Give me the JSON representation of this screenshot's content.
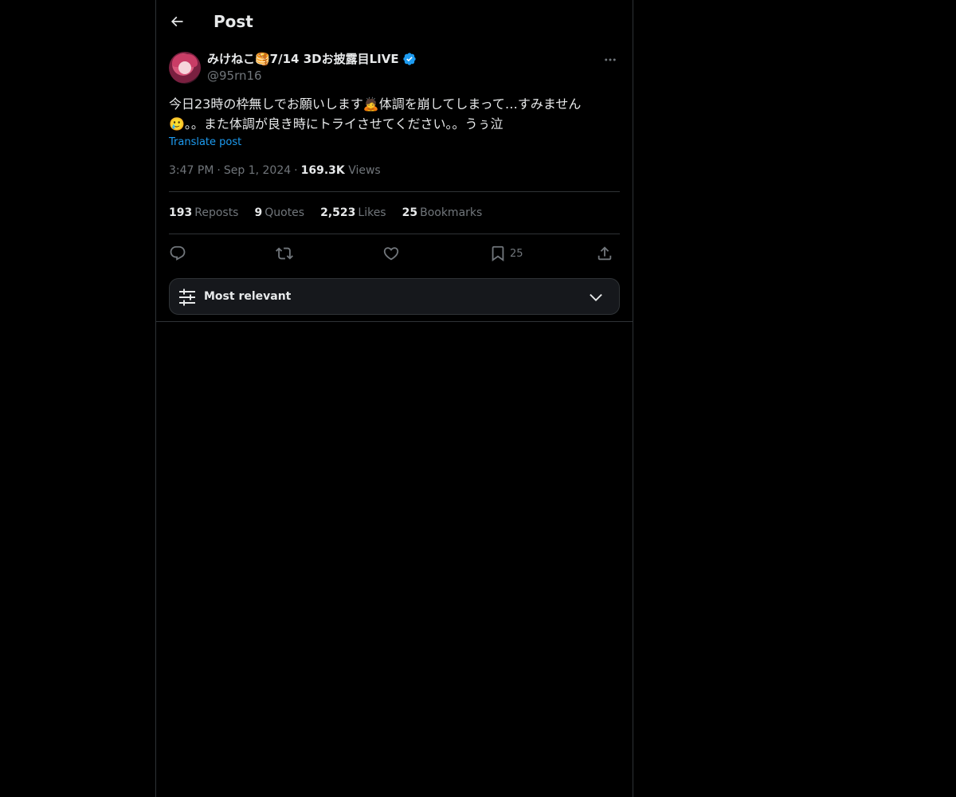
{
  "header": {
    "title": "Post",
    "back_icon": "arrow-left-icon"
  },
  "author": {
    "display_name": "みけねこ🥞7/14 3Dお披露目LIVE",
    "handle": "@95rn16",
    "verified": true,
    "verified_color": "#1d9bf0"
  },
  "post": {
    "text_line1": "今日23時の枠無しでお願いします🙇体調を崩してしまって…すみません",
    "text_line2": "🥲。。また体調が良き時にトライさせてください。。うぅ泣",
    "translate_label": "Translate post",
    "time": "3:47 PM",
    "date": "Sep 1, 2024",
    "views_count": "169.3K",
    "views_label": "Views"
  },
  "stats": {
    "reposts_count": "193",
    "reposts_label": "Reposts",
    "quotes_count": "9",
    "quotes_label": "Quotes",
    "likes_count": "2,523",
    "likes_label": "Likes",
    "bookmarks_count": "25",
    "bookmarks_label": "Bookmarks"
  },
  "actions": {
    "reply_icon": "reply-icon",
    "repost_icon": "repost-icon",
    "like_icon": "heart-icon",
    "bookmark_icon": "bookmark-icon",
    "bookmark_count": "25",
    "share_icon": "share-icon"
  },
  "sort": {
    "label": "Most relevant",
    "icon": "sliders-icon",
    "chevron": "chevron-down-icon"
  },
  "colors": {
    "background": "#000000",
    "text": "#e7e9ea",
    "muted": "#71767b",
    "accent": "#1d9bf0",
    "border": "#2f3336"
  }
}
